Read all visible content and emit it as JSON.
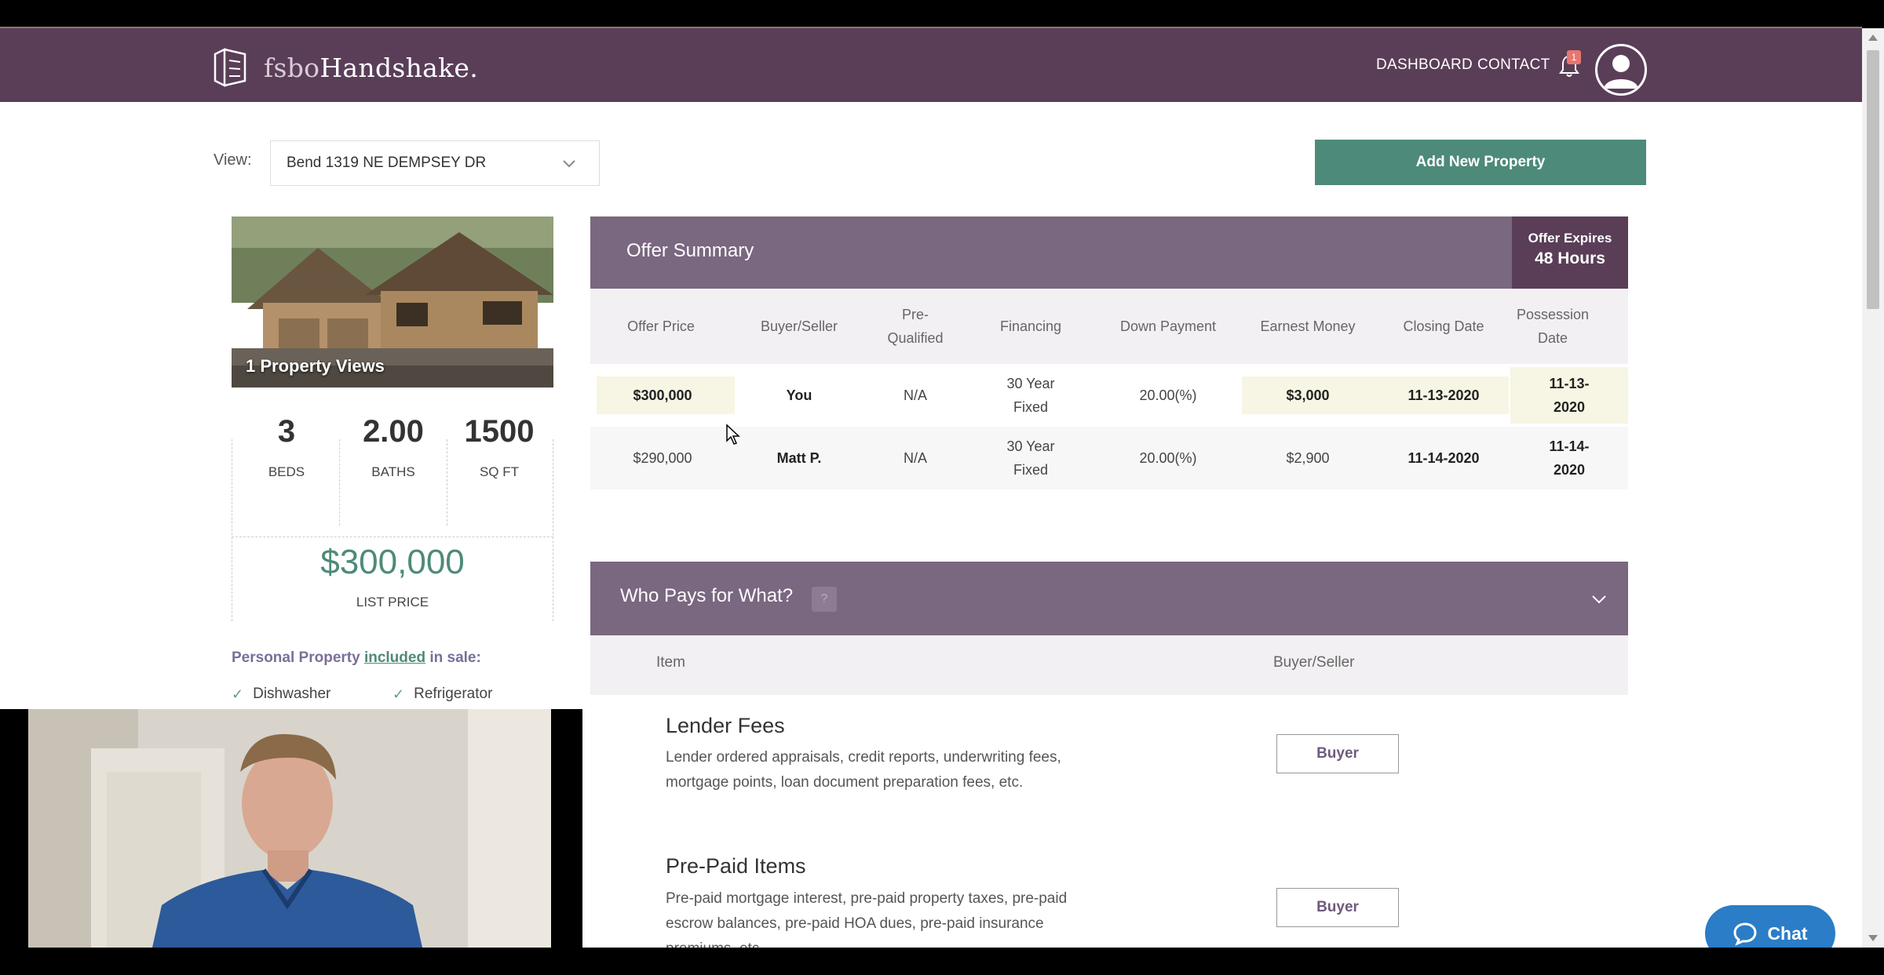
{
  "nav": {
    "logo_light": "fsbo",
    "logo_bold": "Handshake.",
    "dashboard": "DASHBOARD",
    "contact": "CONTACT",
    "notification_count": "1"
  },
  "view": {
    "label": "View:",
    "selected": "Bend 1319 NE DEMPSEY DR"
  },
  "add_property": "Add New Property",
  "property": {
    "views": "1 Property Views",
    "beds": "3",
    "beds_label": "BEDS",
    "baths": "2.00",
    "baths_label": "BATHS",
    "sqft": "1500",
    "sqft_label": "SQ FT",
    "list_price": "$300,000",
    "list_price_label": "LIST PRICE",
    "personal_property_prefix": "Personal Property ",
    "personal_property_included": "included",
    "personal_property_suffix": " in sale:",
    "items": [
      "Dishwasher",
      "Refrigerator"
    ]
  },
  "offer_summary": {
    "title": "Offer Summary",
    "expires_label": "Offer Expires",
    "expires_value": "48 Hours",
    "columns": [
      "Offer Price",
      "Buyer/Seller",
      "Pre-\nQualified",
      "Financing",
      "Down Payment",
      "Earnest Money",
      "Closing Date",
      "Possession\nDate"
    ],
    "rows": [
      {
        "price": "$300,000",
        "party": "You",
        "prequal": "N/A",
        "financing": "30 Year\nFixed",
        "down": "20.00(%)",
        "earnest": "$3,000",
        "closing": "11-13-2020",
        "possession": "11-13-\n2020"
      },
      {
        "price": "$290,000",
        "party": "Matt P.",
        "prequal": "N/A",
        "financing": "30 Year\nFixed",
        "down": "20.00(%)",
        "earnest": "$2,900",
        "closing": "11-14-2020",
        "possession": "11-14-\n2020"
      }
    ]
  },
  "who_pays": {
    "title": "Who Pays for What?",
    "help": "?",
    "col_item": "Item",
    "col_party": "Buyer/Seller",
    "fees": [
      {
        "title": "Lender Fees",
        "desc": "Lender ordered appraisals, credit reports, underwriting fees, mortgage points, loan document preparation fees, etc.",
        "party": "Buyer"
      },
      {
        "title": "Pre-Paid Items",
        "desc": "Pre-paid mortgage interest, pre-paid property taxes, pre-paid escrow balances, pre-paid HOA dues, pre-paid insurance premiums, etc.",
        "party": "Buyer"
      }
    ]
  },
  "chat": "Chat",
  "colors": {
    "nav": "#5a3e58",
    "panel_header": "#7a6780",
    "accent_green": "#4d8a79",
    "chat_blue": "#2a7dc6"
  }
}
